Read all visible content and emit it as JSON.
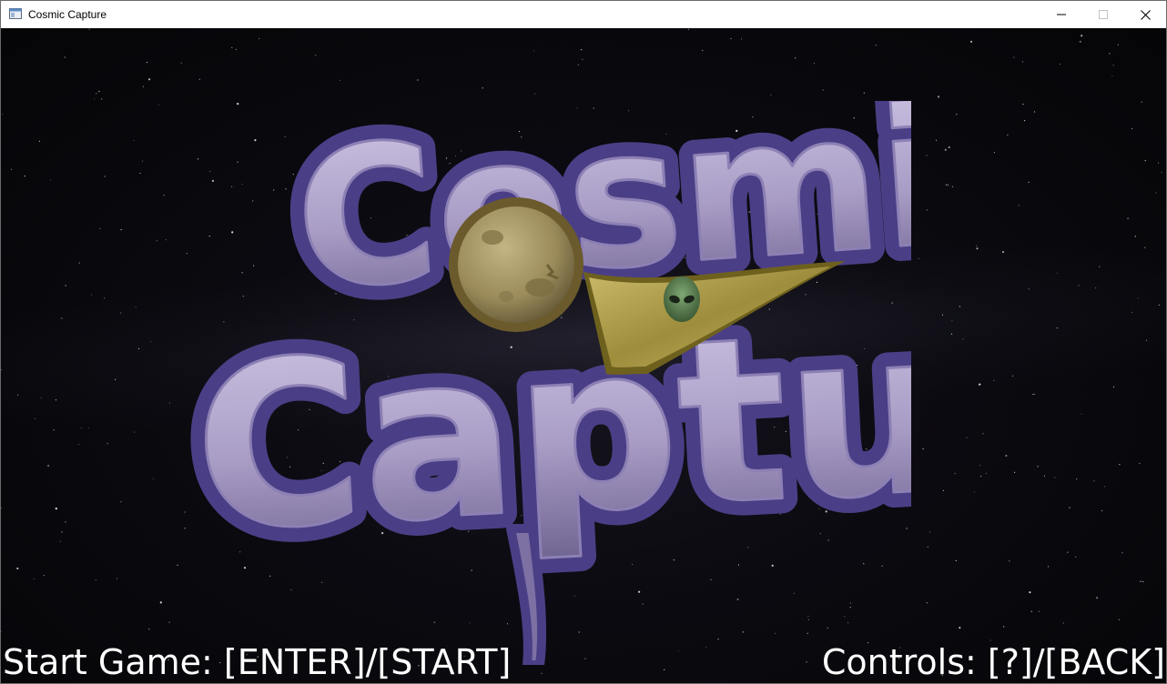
{
  "window": {
    "title": "Cosmic Capture",
    "icon": "app-window-icon",
    "controls": [
      "minimize-icon",
      "maximize-icon",
      "close-icon"
    ]
  },
  "logo": {
    "line1": "Cosmic",
    "line2": "Capture"
  },
  "hints": {
    "start": "Start Game: [ENTER]/[START]",
    "controls": "Controls: [?]/[BACK]"
  },
  "colors": {
    "logo_fill": "#b2a6cc",
    "logo_outline": "#4a3f86",
    "planet": "#a08f5e",
    "banner": "#b3a24f",
    "alien": "#5f8a56",
    "text": "#ffffff",
    "background": "#07070a"
  }
}
